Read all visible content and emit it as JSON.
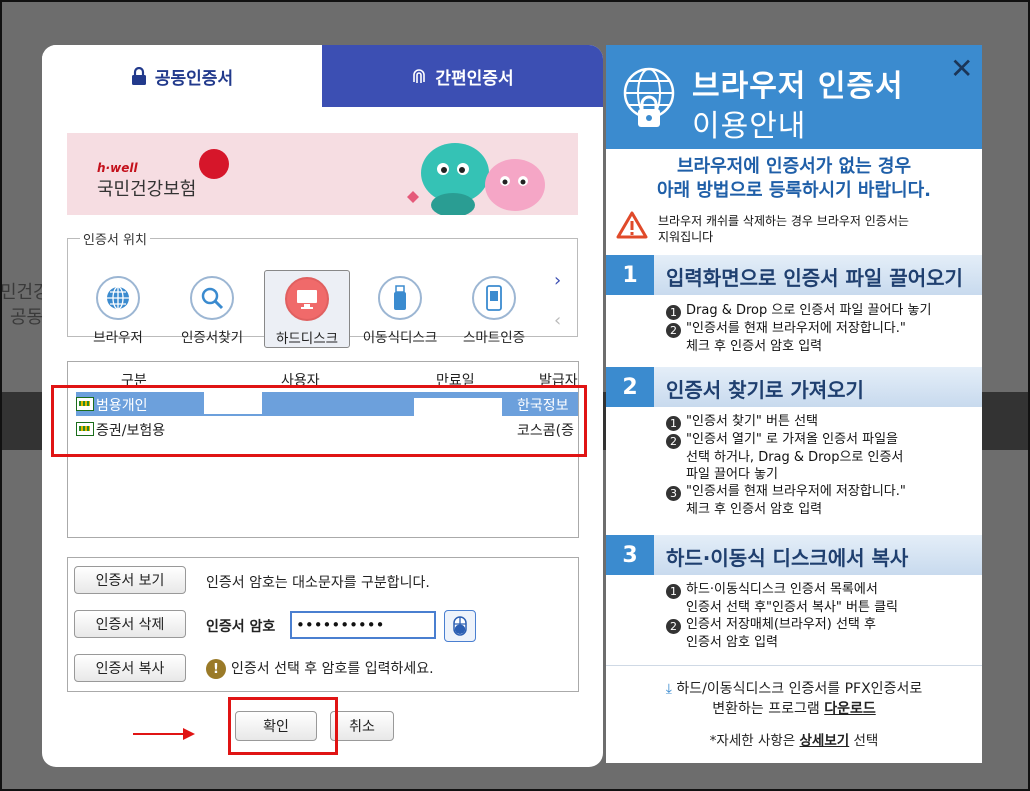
{
  "background": {
    "text_1": "민건강",
    "text_2": "공동"
  },
  "tabs": {
    "joint": "공동인증서",
    "simple": "간편인증서"
  },
  "banner": {
    "brand": "h·well",
    "title": "국민건강보험"
  },
  "location": {
    "legend": "인증서 위치",
    "items": [
      "브라우저",
      "인증서찾기",
      "하드디스크",
      "이동식디스크",
      "스마트인증"
    ],
    "selected": "하드디스크",
    "next_arrow": "›",
    "prev_arrow": "‹"
  },
  "cert_table": {
    "headers": [
      "구분",
      "사용자",
      "만료일",
      "발급자"
    ],
    "rows": [
      {
        "type": "범용개인",
        "issuer": "한국정보"
      },
      {
        "type": "증권/보험용",
        "issuer": "코스콤(증"
      }
    ]
  },
  "buttons": {
    "view": "인증서 보기",
    "delete": "인증서 삭제",
    "copy": "인증서 복사",
    "ok": "확인",
    "cancel": "취소"
  },
  "password": {
    "case_note": "인증서 암호는 대소문자를 구분합니다.",
    "label": "인증서 암호",
    "value": "••••••••••",
    "hint": "인증서 선택 후 암호를 입력하세요."
  },
  "guide": {
    "title_line1": "브라우저 인증서",
    "title_line2": "이용안내",
    "close": "✕",
    "intro_line1": "브라우저에 인증서가 없는 경우",
    "intro_line2": "아래 방법으로 등록하시기 바랍니다.",
    "warning_line1": "브라우저 캐쉬를 삭제하는 경우 브라우저 인증서는",
    "warning_line2": "지워집니다",
    "steps": [
      {
        "num": "1",
        "title": "입력화면으로 인증서 파일 끌어오기",
        "line1": "Drag & Drop 으로 인증서 파일 끌어다 놓기",
        "line2": "\"인증서를 현재 브라우저에 저장합니다.\"",
        "line2b": "체크 후 인증서 암호 입력"
      },
      {
        "num": "2",
        "title": "인증서 찾기로 가져오기",
        "line1": "\"인증서 찾기\" 버튼 선택",
        "line2": "\"인증서 열기\" 로 가져올 인증서 파일을",
        "line2b": "선택 하거나, Drag & Drop으로 인증서",
        "line2c": "파일 끌어다 놓기",
        "line3": "\"인증서를 현재 브라우저에 저장합니다.\"",
        "line3b": "체크 후 인증서 암호 입력"
      },
      {
        "num": "3",
        "title": "하드·이동식 디스크에서 복사",
        "line1": "하드·이동식디스크 인증서 목록에서",
        "line1b": "인증서 선택 후\"인증서 복사\" 버튼 클릭",
        "line2": "인증서 저장매체(브라우저) 선택 후",
        "line2b": "인증서 암호 입력"
      }
    ],
    "download_line1": "하드/이동식디스크 인증서를 PFX인증서로",
    "download_line2_pre": "변환하는 프로그램 ",
    "download_link": "다운로드",
    "detail_pre": "*자세한 사항은 ",
    "detail_link": "상세보기",
    "detail_post": " 선택"
  },
  "colors": {
    "accent_blue": "#3c4fb3",
    "guide_blue": "#3b8bcf",
    "selection": "#6ca0dc",
    "highlight_red": "#e01414"
  }
}
